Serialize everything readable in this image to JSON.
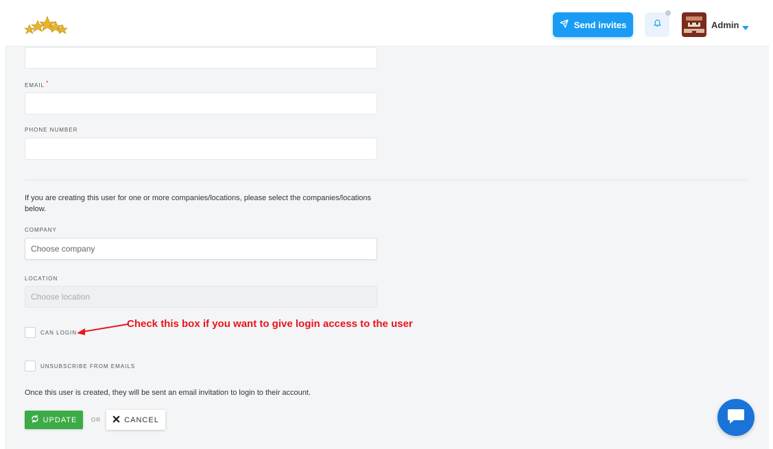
{
  "header": {
    "send_invites_label": "Send invites",
    "user_name": "Admin"
  },
  "form": {
    "email_label": "EMAIL",
    "required_mark": "*",
    "phone_label": "PHONE NUMBER",
    "info_text": "If you are creating this user for one or more companies/locations, please select the companies/locations below.",
    "company_label": "COMPANY",
    "company_placeholder": "Choose company",
    "location_label": "LOCATION",
    "location_placeholder": "Choose location",
    "can_login_label": "CAN LOGIN",
    "unsubscribe_label": "UNSUBSCRIBE FROM EMAILS",
    "note_text": "Once this user is created, they will be sent an email invitation to login to their account."
  },
  "annotation": {
    "text": "Check this box if you want to give login access to the user"
  },
  "actions": {
    "update_label": "UPDATE",
    "or_label": "OR",
    "cancel_label": "CANCEL"
  },
  "colors": {
    "primary": "#1a9cf5",
    "success": "#3bab46",
    "annotation": "#e8141c",
    "chat": "#1a73d9"
  },
  "icons": {
    "logo": "stars-logo",
    "send": "paper-plane-icon",
    "bell": "bell-icon",
    "caret": "caret-down-icon",
    "update": "refresh-icon",
    "cancel": "close-icon",
    "chat": "chat-bubble-icon"
  }
}
